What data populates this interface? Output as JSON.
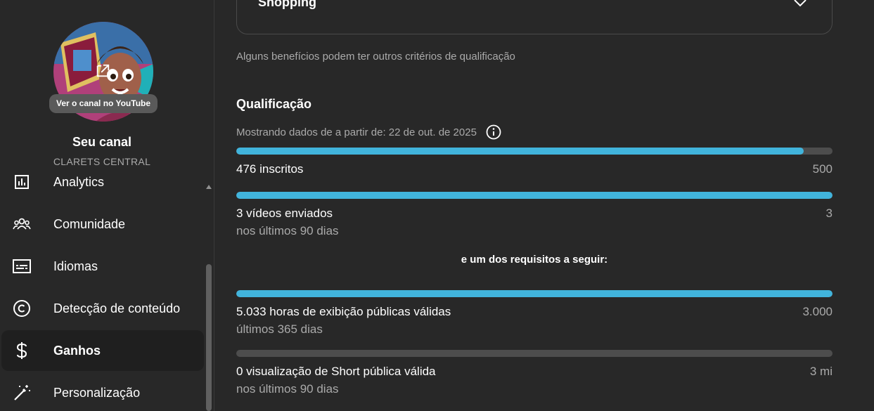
{
  "sidebar": {
    "view_channel_label": "Ver o canal no YouTube",
    "channel_title": "Seu canal",
    "channel_name": "CLARETS CENTRAL",
    "items": [
      {
        "label": "Analytics",
        "icon": "analytics-icon"
      },
      {
        "label": "Comunidade",
        "icon": "community-icon"
      },
      {
        "label": "Idiomas",
        "icon": "subtitles-icon"
      },
      {
        "label": "Detecção de conteúdo",
        "icon": "copyright-icon"
      },
      {
        "label": "Ganhos",
        "icon": "dollar-icon",
        "active": true
      },
      {
        "label": "Personalização",
        "icon": "magic-wand-icon"
      }
    ]
  },
  "main": {
    "shopping_label": "Shopping",
    "note": "Alguns benefícios podem ter outros critérios de qualificação",
    "section_title": "Qualificação",
    "date_line": "Mostrando dados de a partir de: 22 de out. de 2025",
    "requirements": [
      {
        "label": "476 inscritos",
        "target": "500",
        "progress": 0.952
      },
      {
        "label": "3 vídeos enviados",
        "sub": "nos últimos 90 dias",
        "target": "3",
        "progress": 1.0
      }
    ],
    "or_text": "e um dos requisitos a seguir:",
    "optional_requirements": [
      {
        "label": "5.033 horas de exibição públicas válidas",
        "sub": "últimos 365 dias",
        "target": "3.000",
        "progress": 1.0
      },
      {
        "label": "0 visualização de Short pública válida",
        "sub": "nos últimos 90 dias",
        "target": "3 mi",
        "progress": 0.0
      }
    ]
  },
  "colors": {
    "background": "#282828",
    "progress_fill": "#41b4dc",
    "progress_track": "#4d4d4d",
    "muted_text": "#aaaaaa"
  }
}
